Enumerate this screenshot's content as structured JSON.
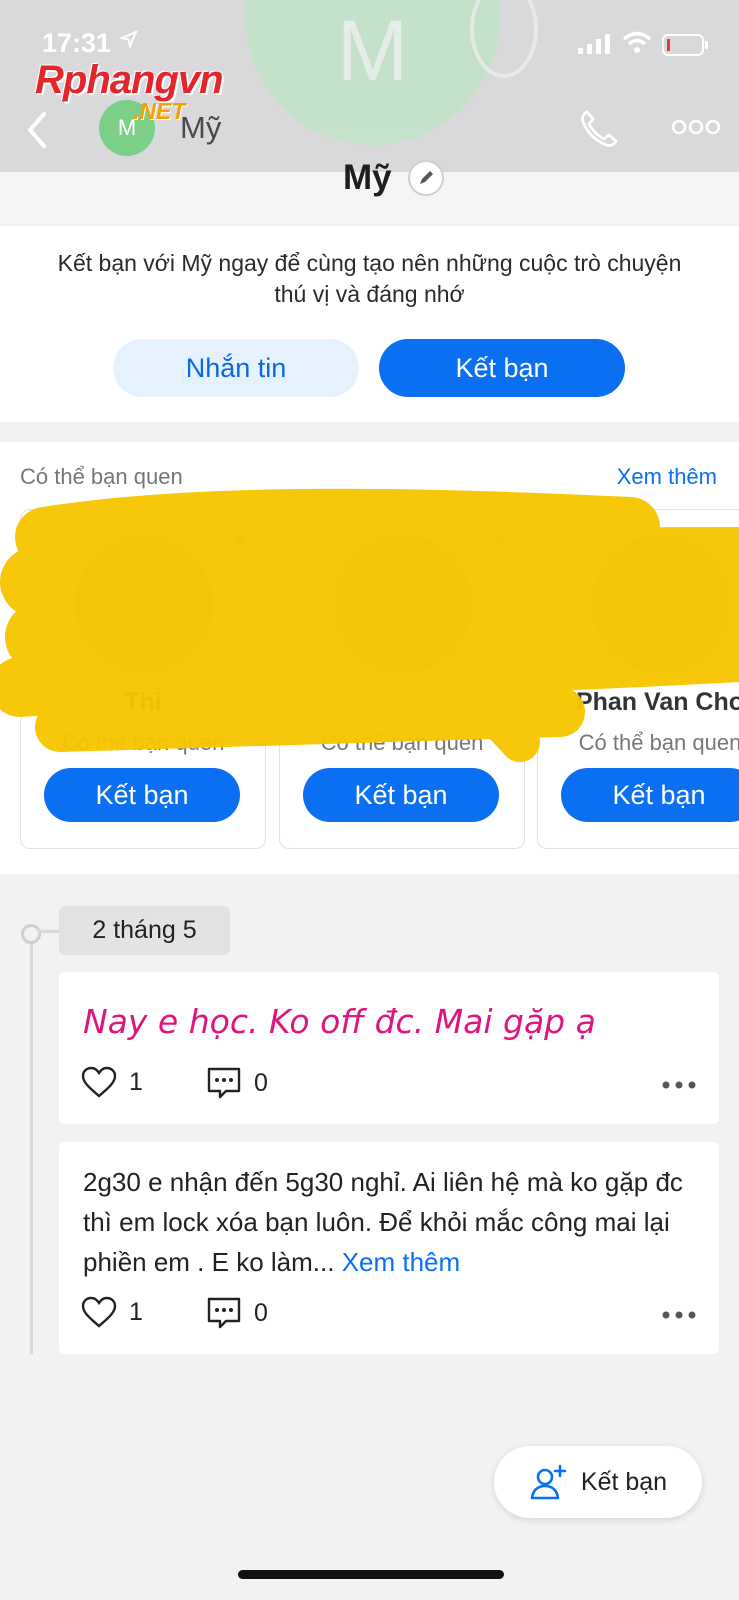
{
  "status_bar": {
    "time": "17:31"
  },
  "watermark": {
    "main": "Rphangvn",
    "sub": ".NET"
  },
  "header": {
    "avatar_letter": "M",
    "name": "Mỹ",
    "background_avatar_letter": "M"
  },
  "profile": {
    "name": "Mỹ"
  },
  "friend_prompt": {
    "message": "Kết bạn với Mỹ ngay để cùng tạo nên những cuộc trò chuyện thú vị và đáng nhớ",
    "message_button": "Nhắn tin",
    "add_button": "Kết bạn"
  },
  "suggestions": {
    "title": "Có thể bạn quen",
    "see_more": "Xem thêm",
    "cards": [
      {
        "name": "Thi",
        "subtitle": "Có thể bạn quen",
        "button": "Kết bạn"
      },
      {
        "name": "",
        "subtitle": "Có thể bạn quen",
        "button": "Kết bạn"
      },
      {
        "name": "Phan Van Cho",
        "subtitle": "Có thể bạn quen",
        "button": "Kết bạn"
      }
    ]
  },
  "timeline": {
    "date": "2 tháng 5",
    "posts": [
      {
        "text": "Nay e học. Ko off đc. Mai gặp ạ",
        "likes": "1",
        "comments": "0"
      },
      {
        "text": "2g30 e nhận đến 5g30 nghỉ. Ai liên hệ mà ko gặp đc thì em lock xóa bạn luôn. Để khỏi mắc công mai lại phiền em . E ko làm...",
        "more": "Xem thêm",
        "likes": "1",
        "comments": "0"
      }
    ]
  },
  "fab": {
    "label": "Kết bạn"
  },
  "colors": {
    "accent": "#0a6ff0",
    "fancy_text": "#e0147d",
    "scribble": "#f7c600"
  }
}
